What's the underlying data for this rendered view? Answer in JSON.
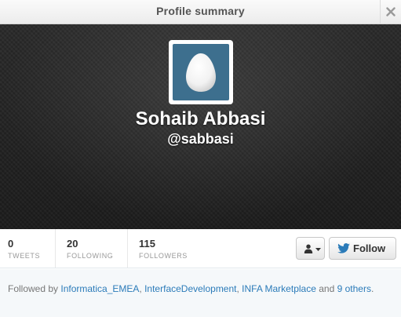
{
  "modal": {
    "title": "Profile summary",
    "close_icon": "close-icon"
  },
  "profile": {
    "fullname": "Sohaib Abbasi",
    "screenname": "@sabbasi",
    "avatar_icon": "default-egg-avatar",
    "avatar_bg_color": "#3d6f8e"
  },
  "stats": {
    "tweets": {
      "count": "0",
      "label": "TWEETS"
    },
    "following": {
      "count": "20",
      "label": "FOLLOWING"
    },
    "followers": {
      "count": "115",
      "label": "FOLLOWERS"
    }
  },
  "actions": {
    "user_menu_icon": "person-icon",
    "follow_label": "Follow",
    "follow_icon": "twitter-bird-icon",
    "brand_color": "#2b7bb9"
  },
  "followed_by": {
    "prefix": "Followed by ",
    "accounts": [
      "Informatica_EMEA",
      "InterfaceDevelopment",
      "INFA Marketplace"
    ],
    "sep1": ", ",
    "sep2": ", ",
    "and_text": " and ",
    "others_link": "9 others",
    "suffix": "."
  }
}
